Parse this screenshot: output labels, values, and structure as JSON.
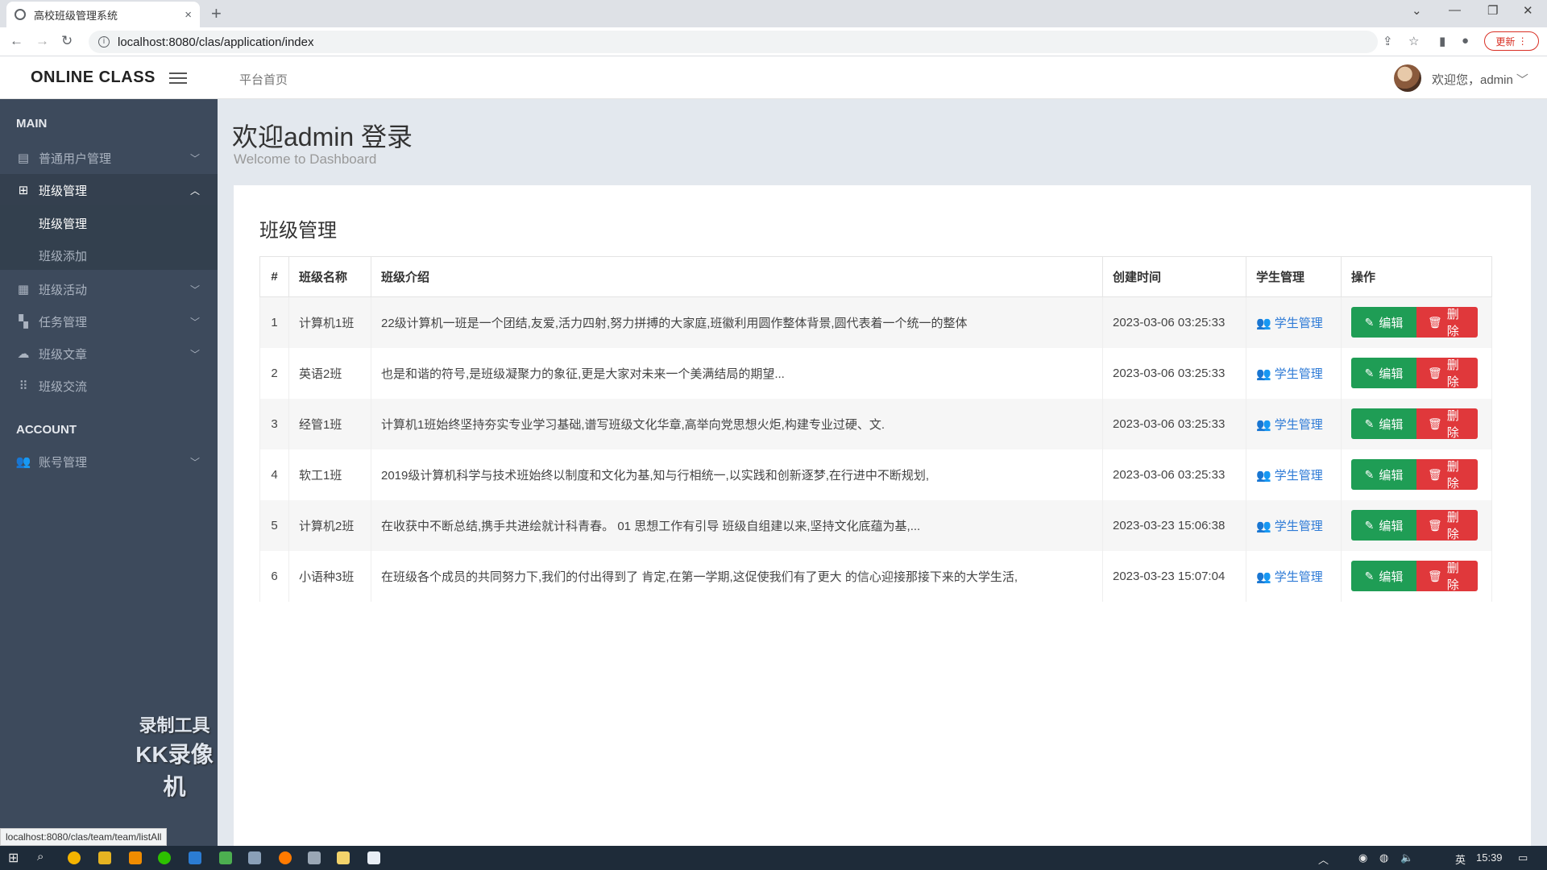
{
  "browser": {
    "tab_title": "高校班级管理系统",
    "tab_close": "×",
    "new_tab": "+",
    "url": "localhost:8080/clas/application/index",
    "update_label": "更新",
    "status_url": "localhost:8080/clas/team/team/listAll"
  },
  "header": {
    "brand": "ONLINE CLASS",
    "breadcrumb": "平台首页",
    "welcome": "欢迎您，admin"
  },
  "sidebar": {
    "section_main": "MAIN",
    "section_account": "ACCOUNT",
    "items": [
      {
        "label": "普通用户管理",
        "icon": "user-list-icon"
      },
      {
        "label": "班级管理",
        "icon": "grid-icon"
      },
      {
        "label": "班级活动",
        "icon": "table-icon"
      },
      {
        "label": "任务管理",
        "icon": "tiles-icon"
      },
      {
        "label": "班级文章",
        "icon": "cloud-icon"
      },
      {
        "label": "班级交流",
        "icon": "dots-icon"
      },
      {
        "label": "账号管理",
        "icon": "users-icon"
      }
    ],
    "submenu": [
      {
        "label": "班级管理"
      },
      {
        "label": "班级添加"
      }
    ],
    "watermark_line1": "录制工具",
    "watermark_line2": "KK录像机"
  },
  "page": {
    "title": "欢迎admin 登录",
    "subtitle": "Welcome to Dashboard",
    "card_title": "班级管理"
  },
  "table": {
    "headers": [
      "#",
      "班级名称",
      "班级介绍",
      "创建时间",
      "学生管理",
      "操作"
    ],
    "edit_label": "编辑",
    "delete_label": "删除",
    "student_link_label": "学生管理",
    "rows": [
      {
        "id": "1",
        "name": "计算机1班",
        "intro": "22级计算机一班是一个团结,友爱,活力四射,努力拼搏的大家庭,班徽利用圆作整体背景,圆代表着一个统一的整体",
        "created": "2023-03-06 03:25:33"
      },
      {
        "id": "2",
        "name": "英语2班",
        "intro": "也是和谐的符号,是班级凝聚力的象征,更是大家对未来一个美满结局的期望...",
        "created": "2023-03-06 03:25:33"
      },
      {
        "id": "3",
        "name": "经管1班",
        "intro": "计算机1班始终坚持夯实专业学习基础,谱写班级文化华章,高举向党思想火炬,构建专业过硬、文.",
        "created": "2023-03-06 03:25:33"
      },
      {
        "id": "4",
        "name": "软工1班",
        "intro": "2019级计算机科学与技术班始终以制度和文化为基,知与行相统一,以实践和创新逐梦,在行进中不断规划,",
        "created": "2023-03-06 03:25:33"
      },
      {
        "id": "5",
        "name": "计算机2班",
        "intro": "在收获中不断总结,携手共进绘就计科青春。 01 思想工作有引导 班级自组建以来,坚持文化底蕴为基,...",
        "created": "2023-03-23 15:06:38"
      },
      {
        "id": "6",
        "name": "小语种3班",
        "intro": "在班级各个成员的共同努力下,我们的付出得到了 肯定,在第一学期,这促使我们有了更大 的信心迎接那接下来的大学生活,",
        "created": "2023-03-23 15:07:04"
      }
    ]
  },
  "taskbar": {
    "ime": "英",
    "time": "15:39"
  }
}
